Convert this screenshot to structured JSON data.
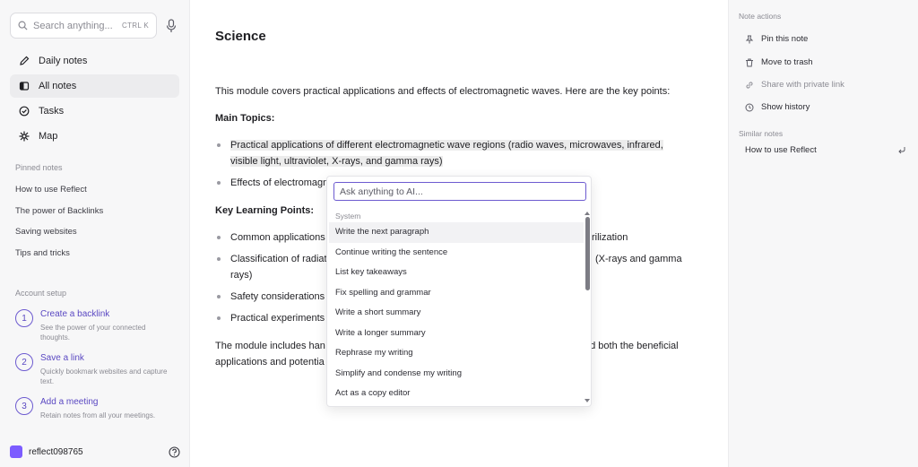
{
  "search": {
    "placeholder": "Search anything...",
    "shortcut": "CTRL K"
  },
  "nav": [
    {
      "label": "Daily notes",
      "icon": "pencil-icon"
    },
    {
      "label": "All notes",
      "icon": "notes-icon"
    },
    {
      "label": "Tasks",
      "icon": "check-circle-icon"
    },
    {
      "label": "Map",
      "icon": "graph-icon"
    }
  ],
  "pinned": {
    "label": "Pinned notes",
    "items": [
      "How to use Reflect",
      "The power of Backlinks",
      "Saving websites",
      "Tips and tricks"
    ]
  },
  "setup": {
    "label": "Account setup",
    "items": [
      {
        "num": "1",
        "title": "Create a backlink",
        "desc": "See the power of your connected thoughts."
      },
      {
        "num": "2",
        "title": "Save a link",
        "desc": "Quickly bookmark websites and capture text."
      },
      {
        "num": "3",
        "title": "Add a meeting",
        "desc": "Retain notes from all your meetings."
      }
    ]
  },
  "user": {
    "name": "reflect098765",
    "color": "#7c5cff"
  },
  "note": {
    "title": "Science",
    "intro": "This module covers practical applications and effects of electromagnetic waves. Here are the key points:",
    "main_topics_heading": "Main Topics:",
    "bullet1_line1": "Practical applications of different electromagnetic wave regions (radio waves, microwaves, infrared,",
    "bullet1_line2": "visible light, ultraviolet, X-rays, and gamma rays)",
    "bullet2": "Effects of electromagn",
    "key_points_heading": "Key Learning Points:",
    "kp1_a": "Common applications",
    "kp1_b": "rilization",
    "kp2_a": "Classification of radiat",
    "kp2_b": "(X-rays and gamma",
    "kp2_c": "rays)",
    "kp3": "Safety considerations",
    "kp4": "Practical experiments",
    "outro1_a": "The module includes han",
    "outro1_b": "nd both the beneficial",
    "outro2": "applications and potentia"
  },
  "ai_popup": {
    "placeholder": "Ask anything to AI...",
    "section": "System",
    "items": [
      "Write the next paragraph",
      "Continue writing the sentence",
      "List key takeaways",
      "Fix spelling and grammar",
      "Write a short summary",
      "Write a longer summary",
      "Rephrase my writing",
      "Simplify and condense my writing",
      "Act as a copy editor"
    ]
  },
  "right_panel": {
    "actions_label": "Note actions",
    "actions": [
      "Pin this note",
      "Move to trash",
      "Share with private link",
      "Show history"
    ],
    "similar_label": "Similar notes",
    "similar": [
      "How to use Reflect"
    ]
  },
  "colors": {
    "accent": "#6d5bd0",
    "sidebar_bg": "#f7f7f8"
  }
}
